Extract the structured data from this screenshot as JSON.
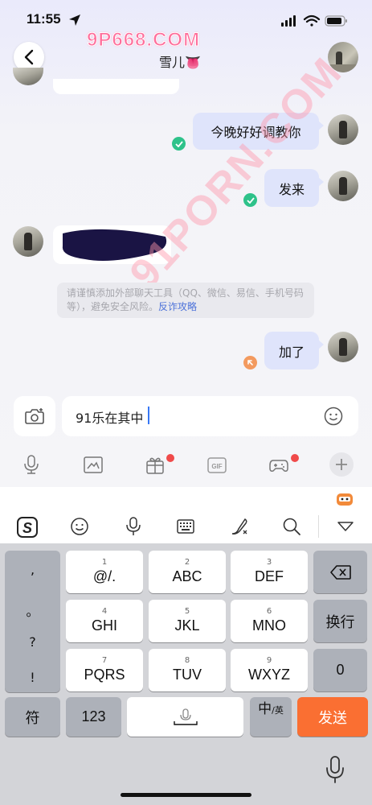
{
  "status_bar": {
    "time": "11:55"
  },
  "header": {
    "watermark": "9P668.COM",
    "title": "雪儿👅"
  },
  "messages": [
    {
      "side": "out",
      "text": "今晚好好调教你",
      "status": "read"
    },
    {
      "side": "out",
      "text": "发来",
      "status": "read"
    },
    {
      "side": "in",
      "text": ""
    },
    {
      "side": "out",
      "text": "加了",
      "status": "sending"
    }
  ],
  "notice": {
    "text": "请谨慎添加外部聊天工具（QQ、微信、易信、手机号码等），避免安全风险。",
    "link": "反诈攻略"
  },
  "diagonal_watermark": "91PORN.COM",
  "input": {
    "value": "91乐在其中"
  },
  "keyboard": {
    "punct": [
      ",",
      "。",
      "?",
      "!"
    ],
    "rows": [
      [
        {
          "num": "1",
          "label": "@/."
        },
        {
          "num": "2",
          "label": "ABC"
        },
        {
          "num": "3",
          "label": "DEF"
        }
      ],
      [
        {
          "num": "4",
          "label": "GHI"
        },
        {
          "num": "5",
          "label": "JKL"
        },
        {
          "num": "6",
          "label": "MNO"
        }
      ],
      [
        {
          "num": "7",
          "label": "PQRS"
        },
        {
          "num": "8",
          "label": "TUV"
        },
        {
          "num": "9",
          "label": "WXYZ"
        }
      ]
    ],
    "newline": "换行",
    "zero": "0",
    "symbol": "符",
    "numbers": "123",
    "lang_main": "中",
    "lang_sub": "/英",
    "send": "发送"
  },
  "colors": {
    "bubble_out": "#dfe4fb",
    "read_tick": "#2ec28a",
    "send_key": "#fa6f32",
    "link": "#4d72d9"
  },
  "icons": {
    "status": [
      "location-arrow-icon",
      "signal-icon",
      "wifi-icon",
      "battery-icon"
    ],
    "toolbar": [
      "microphone-icon",
      "image-icon",
      "gift-icon",
      "gif-icon",
      "game-controller-icon",
      "plus-icon"
    ],
    "kb_toolbar": [
      "sogou-logo-icon",
      "emoji-icon",
      "microphone-icon",
      "keyboard-icon",
      "handwriting-icon",
      "search-icon",
      "collapse-icon"
    ]
  }
}
